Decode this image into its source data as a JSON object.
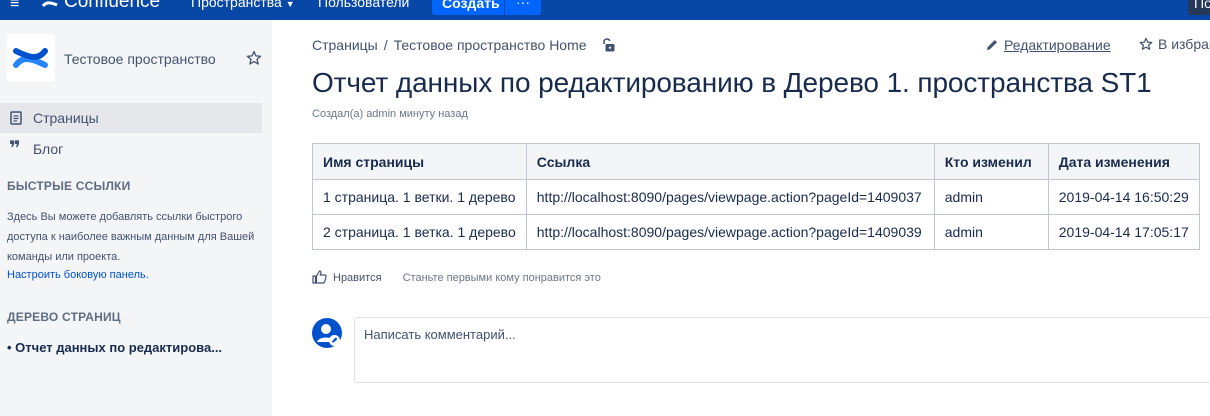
{
  "topbar": {
    "menu_glyph": "≡",
    "logo_text": "Confluence",
    "spaces_label": "Пространства",
    "users_label": "Пользователи",
    "create_label": "Создать",
    "more_glyph": "···",
    "right_btn": "По"
  },
  "sidebar": {
    "space_name": "Тестовое пространство",
    "nav": [
      {
        "label": "Страницы",
        "icon": "page-icon"
      },
      {
        "label": "Блог",
        "icon": "quote-icon"
      }
    ],
    "quick_links": {
      "heading": "БЫСТРЫЕ ССЫЛКИ",
      "text": "Здесь Вы можете добавлять ссылки быстрого доступа к наиболее важным данным для Вашей команды или проекта.",
      "link": "Настроить боковую панель."
    },
    "page_tree": {
      "heading": "ДЕРЕВО СТРАНИЦ",
      "item": "•  Отчет данных по редактирова..."
    }
  },
  "breadcrumb": {
    "items": [
      "Страницы",
      "Тестовое пространство Home"
    ],
    "separator": "/"
  },
  "actions": {
    "edit_label": "Редактирование",
    "favorite_label": "В избранное"
  },
  "page": {
    "title": "Отчет данных по редактированию в Дерево 1. пространства ST1",
    "byline": "Создал(а) admin минуту назад"
  },
  "table": {
    "headers": [
      "Имя страницы",
      "Ссылка",
      "Кто изменил",
      "Дата изменения"
    ],
    "rows": [
      [
        "1 страница. 1 ветки. 1 дерево",
        "http://localhost:8090/pages/viewpage.action?pageId=1409037",
        "admin",
        "2019-04-14 16:50:29"
      ],
      [
        "2 страница. 1 ветка. 1 дерево",
        "http://localhost:8090/pages/viewpage.action?pageId=1409039",
        "admin",
        "2019-04-14 17:05:17"
      ]
    ]
  },
  "likes": {
    "like_label": "Нравится",
    "first_text": "Станьте первыми кому понравится это"
  },
  "comment": {
    "placeholder": "Написать комментарий..."
  },
  "colors": {
    "topbar": "#0747a6",
    "create_button": "#0065ff",
    "link": "#0052cc",
    "sidebar_bg": "#f4f5f7"
  }
}
